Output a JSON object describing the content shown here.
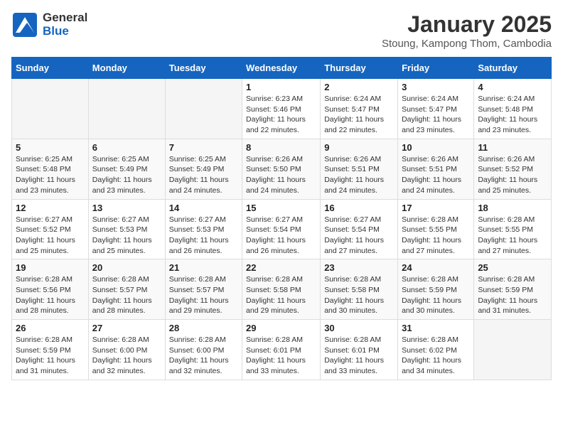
{
  "header": {
    "logo_general": "General",
    "logo_blue": "Blue",
    "month_title": "January 2025",
    "location": "Stoung, Kampong Thom, Cambodia"
  },
  "weekdays": [
    "Sunday",
    "Monday",
    "Tuesday",
    "Wednesday",
    "Thursday",
    "Friday",
    "Saturday"
  ],
  "weeks": [
    [
      {
        "day": "",
        "info": ""
      },
      {
        "day": "",
        "info": ""
      },
      {
        "day": "",
        "info": ""
      },
      {
        "day": "1",
        "info": "Sunrise: 6:23 AM\nSunset: 5:46 PM\nDaylight: 11 hours\nand 22 minutes."
      },
      {
        "day": "2",
        "info": "Sunrise: 6:24 AM\nSunset: 5:47 PM\nDaylight: 11 hours\nand 22 minutes."
      },
      {
        "day": "3",
        "info": "Sunrise: 6:24 AM\nSunset: 5:47 PM\nDaylight: 11 hours\nand 23 minutes."
      },
      {
        "day": "4",
        "info": "Sunrise: 6:24 AM\nSunset: 5:48 PM\nDaylight: 11 hours\nand 23 minutes."
      }
    ],
    [
      {
        "day": "5",
        "info": "Sunrise: 6:25 AM\nSunset: 5:48 PM\nDaylight: 11 hours\nand 23 minutes."
      },
      {
        "day": "6",
        "info": "Sunrise: 6:25 AM\nSunset: 5:49 PM\nDaylight: 11 hours\nand 23 minutes."
      },
      {
        "day": "7",
        "info": "Sunrise: 6:25 AM\nSunset: 5:49 PM\nDaylight: 11 hours\nand 24 minutes."
      },
      {
        "day": "8",
        "info": "Sunrise: 6:26 AM\nSunset: 5:50 PM\nDaylight: 11 hours\nand 24 minutes."
      },
      {
        "day": "9",
        "info": "Sunrise: 6:26 AM\nSunset: 5:51 PM\nDaylight: 11 hours\nand 24 minutes."
      },
      {
        "day": "10",
        "info": "Sunrise: 6:26 AM\nSunset: 5:51 PM\nDaylight: 11 hours\nand 24 minutes."
      },
      {
        "day": "11",
        "info": "Sunrise: 6:26 AM\nSunset: 5:52 PM\nDaylight: 11 hours\nand 25 minutes."
      }
    ],
    [
      {
        "day": "12",
        "info": "Sunrise: 6:27 AM\nSunset: 5:52 PM\nDaylight: 11 hours\nand 25 minutes."
      },
      {
        "day": "13",
        "info": "Sunrise: 6:27 AM\nSunset: 5:53 PM\nDaylight: 11 hours\nand 25 minutes."
      },
      {
        "day": "14",
        "info": "Sunrise: 6:27 AM\nSunset: 5:53 PM\nDaylight: 11 hours\nand 26 minutes."
      },
      {
        "day": "15",
        "info": "Sunrise: 6:27 AM\nSunset: 5:54 PM\nDaylight: 11 hours\nand 26 minutes."
      },
      {
        "day": "16",
        "info": "Sunrise: 6:27 AM\nSunset: 5:54 PM\nDaylight: 11 hours\nand 27 minutes."
      },
      {
        "day": "17",
        "info": "Sunrise: 6:28 AM\nSunset: 5:55 PM\nDaylight: 11 hours\nand 27 minutes."
      },
      {
        "day": "18",
        "info": "Sunrise: 6:28 AM\nSunset: 5:55 PM\nDaylight: 11 hours\nand 27 minutes."
      }
    ],
    [
      {
        "day": "19",
        "info": "Sunrise: 6:28 AM\nSunset: 5:56 PM\nDaylight: 11 hours\nand 28 minutes."
      },
      {
        "day": "20",
        "info": "Sunrise: 6:28 AM\nSunset: 5:57 PM\nDaylight: 11 hours\nand 28 minutes."
      },
      {
        "day": "21",
        "info": "Sunrise: 6:28 AM\nSunset: 5:57 PM\nDaylight: 11 hours\nand 29 minutes."
      },
      {
        "day": "22",
        "info": "Sunrise: 6:28 AM\nSunset: 5:58 PM\nDaylight: 11 hours\nand 29 minutes."
      },
      {
        "day": "23",
        "info": "Sunrise: 6:28 AM\nSunset: 5:58 PM\nDaylight: 11 hours\nand 30 minutes."
      },
      {
        "day": "24",
        "info": "Sunrise: 6:28 AM\nSunset: 5:59 PM\nDaylight: 11 hours\nand 30 minutes."
      },
      {
        "day": "25",
        "info": "Sunrise: 6:28 AM\nSunset: 5:59 PM\nDaylight: 11 hours\nand 31 minutes."
      }
    ],
    [
      {
        "day": "26",
        "info": "Sunrise: 6:28 AM\nSunset: 5:59 PM\nDaylight: 11 hours\nand 31 minutes."
      },
      {
        "day": "27",
        "info": "Sunrise: 6:28 AM\nSunset: 6:00 PM\nDaylight: 11 hours\nand 32 minutes."
      },
      {
        "day": "28",
        "info": "Sunrise: 6:28 AM\nSunset: 6:00 PM\nDaylight: 11 hours\nand 32 minutes."
      },
      {
        "day": "29",
        "info": "Sunrise: 6:28 AM\nSunset: 6:01 PM\nDaylight: 11 hours\nand 33 minutes."
      },
      {
        "day": "30",
        "info": "Sunrise: 6:28 AM\nSunset: 6:01 PM\nDaylight: 11 hours\nand 33 minutes."
      },
      {
        "day": "31",
        "info": "Sunrise: 6:28 AM\nSunset: 6:02 PM\nDaylight: 11 hours\nand 34 minutes."
      },
      {
        "day": "",
        "info": ""
      }
    ]
  ]
}
